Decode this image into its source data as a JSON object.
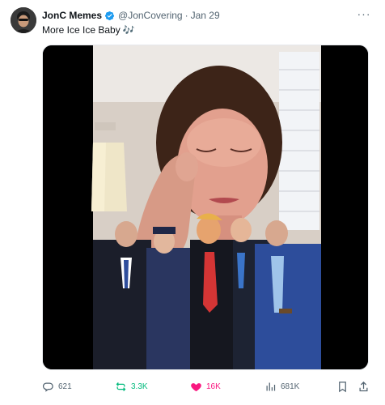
{
  "post": {
    "author_name": "JonC Memes",
    "author_handle": "@JonCovering",
    "separator": "·",
    "timestamp": "Jan 29",
    "text": "More Ice Ice Baby",
    "emoji": "🎶",
    "verified": true,
    "media_type": "video"
  },
  "actions": {
    "replies": "621",
    "reposts": "3.3K",
    "likes": "16K",
    "views": "681K",
    "liked": true,
    "reposted": true
  },
  "icons": [
    "verified-badge-icon",
    "more-icon",
    "reply-icon",
    "repost-icon",
    "like-icon",
    "views-icon",
    "bookmark-icon",
    "share-icon"
  ],
  "colors": {
    "text": "#0f1419",
    "muted": "#536471",
    "verified": "#1d9bf0",
    "repost_active": "#00ba7c",
    "like_active": "#f91880"
  }
}
